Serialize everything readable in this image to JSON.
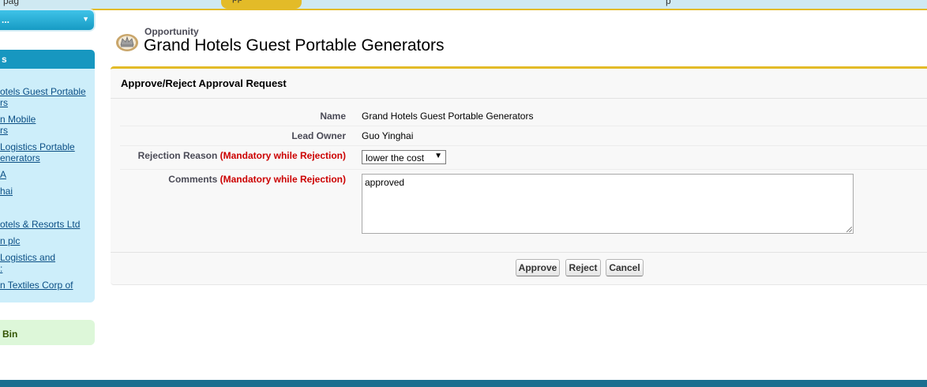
{
  "top_tabs": {
    "left_fragment": "pag",
    "active_fragment": "pp",
    "right_fragment": "p"
  },
  "sidebar": {
    "create_new": {
      "label": "..."
    },
    "recent_items": {
      "header": "s",
      "links": [
        "otels Guest Portable\nrs",
        "n Mobile\nrs",
        "Logistics Portable\nenerators",
        "A",
        "hai",
        "otels & Resorts Ltd",
        "n plc",
        "Logistics and\n:",
        "n Textiles Corp of"
      ]
    },
    "recycle_bin": {
      "label": "Bin"
    }
  },
  "header": {
    "object_type": "Opportunity",
    "title": "Grand Hotels Guest Portable Generators"
  },
  "approval": {
    "section_title": "Approve/Reject Approval Request",
    "fields": {
      "name": {
        "label": "Name",
        "value": "Grand Hotels Guest Portable Generators"
      },
      "lead_owner": {
        "label": "Lead Owner",
        "value": "Guo Yinghai"
      },
      "rejection_reason": {
        "label": "Rejection Reason",
        "required_note": "(Mandatory while Rejection)",
        "selected": "lower the cost"
      },
      "comments": {
        "label": "Comments",
        "required_note": "(Mandatory while Rejection)",
        "value": "approved"
      }
    },
    "buttons": {
      "approve": "Approve",
      "reject": "Reject",
      "cancel": "Cancel"
    }
  },
  "colors": {
    "accent_yellow": "#e3bb28",
    "sidebar_blue": "#1797c0",
    "required_red": "#cc0000",
    "footer_blue": "#1b6e8f"
  }
}
